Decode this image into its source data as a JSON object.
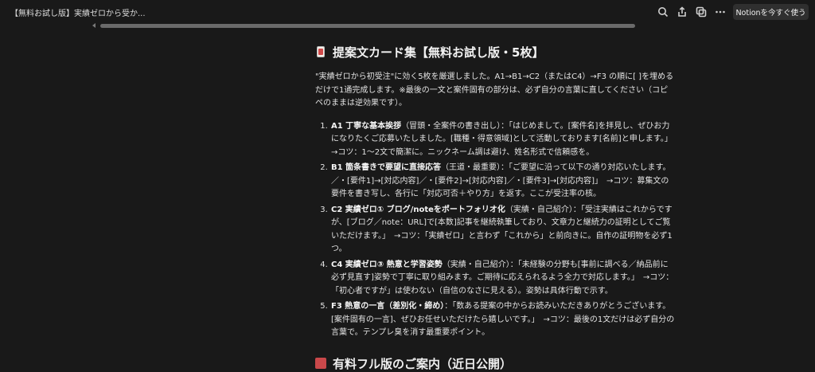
{
  "window": {
    "title": "【無料お試し版】実績ゼロから受か...",
    "cta_label": "Notionを今すぐ使う"
  },
  "icons": {
    "search": "search-icon",
    "share": "share-icon",
    "duplicate": "duplicate-icon",
    "more": "more-icon",
    "page": "card-icon"
  },
  "page": {
    "heading": "提案文カード集【無料お試し版・5枚】",
    "intro": "\"実績ゼロから初受注\"に効く5枚を厳選しました。A1→B1→C2（またはC4）→F3 の順に[ ]を埋めるだけで1通完成します。※最後の一文と案件固有の部分は、必ず自分の言葉に直してください（コピペのままは逆効果です）。",
    "items": [
      {
        "title": "A1 丁寧な基本挨拶",
        "body": "（冒頭・全案件の書き出し）：「はじめまして。[案件名]を拝見し、ぜひお力になりたくご応募いたしました。[職種・得意領域]として活動しております[名前]と申します。」　→コツ：1〜2文で簡潔に。ニックネーム調は避け、姓名形式で信頼感を。"
      },
      {
        "title": "B1 箇条書きで要望に直接応答",
        "body": "（王道・最重要）：「ご要望に沿って以下の通り対応いたします。／・[要件1]→[対応内容]／・[要件2]→[対応内容]／・[要件3]→[対応内容]」　→コツ：募集文の要件を書き写し、各行に「対応可否＋やり方」を返す。ここが受注率の核。"
      },
      {
        "title": "C2 実績ゼロ① ブログ/noteをポートフォリオ化",
        "body": "（実績・自己紹介）：「受注実績はこれからですが、[ブログ／note：URL]で[本数]記事を継続執筆しており、文章力と継続力の証明としてご覧いただけます。」　→コツ：「実績ゼロ」と言わず「これから」と前向きに。自作の証明物を必ず1つ。"
      },
      {
        "title": "C4 実績ゼロ③ 熱意と学習姿勢",
        "body": "（実績・自己紹介）：「未経験の分野も[事前に調べる／納品前に必ず見直す]姿勢で丁寧に取り組みます。ご期待に応えられるよう全力で対応します。」　→コツ：「初心者ですが」は使わない（自信のなさに見える）。姿勢は具体行動で示す。"
      },
      {
        "title": "F3 熱意の一言（差別化・締め）",
        "body": "：「数ある提案の中からお読みいただきありがとうございます。[案件固有の一言]、ぜひお任せいただけたら嬉しいです。」　→コツ：最後の1文だけは必ず自分の言葉で。テンプレ臭を消す最重要ポイント。"
      }
    ],
    "next_heading": "有料フル版のご案内（近日公開）",
    "next_icon": "gift-icon"
  }
}
